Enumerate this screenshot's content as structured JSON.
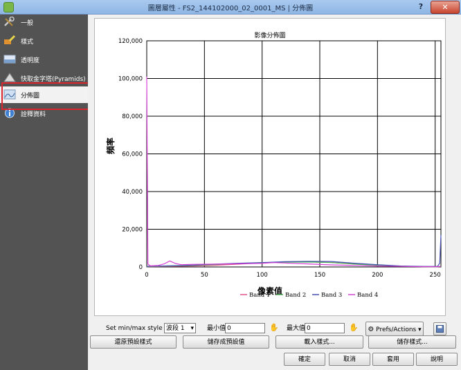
{
  "window": {
    "title": "圖層屬性 - FS2_144102000_02_0001_MS | 分佈圖",
    "help_label": "?",
    "close_label": "✕"
  },
  "sidebar": {
    "items": [
      {
        "label": "一般",
        "icon": "wrench-icon"
      },
      {
        "label": "樣式",
        "icon": "paintbrush-icon"
      },
      {
        "label": "透明度",
        "icon": "transparency-icon"
      },
      {
        "label": "快取金字塔(Pyramids)",
        "icon": "pyramid-icon"
      },
      {
        "label": "分佈圖",
        "icon": "histogram-icon"
      },
      {
        "label": "詮釋資料",
        "icon": "info-icon"
      }
    ],
    "selected_index": 4
  },
  "chart_data": {
    "type": "line",
    "title": "影像分佈圖",
    "xlabel": "像素值",
    "ylabel": "頻率",
    "xlim": [
      0,
      255
    ],
    "ylim": [
      0,
      120000
    ],
    "xticks": [
      "0",
      "50",
      "100",
      "150",
      "200",
      "250"
    ],
    "yticks": [
      "0",
      "20,000",
      "40,000",
      "60,000",
      "80,000",
      "100,000",
      "120,000"
    ],
    "legend_position": "bottom",
    "series": [
      {
        "name": "Band 1",
        "color": "#e2508a",
        "points": [
          [
            0,
            0
          ],
          [
            1,
            200
          ],
          [
            5,
            200
          ],
          [
            20,
            300
          ],
          [
            40,
            500
          ],
          [
            60,
            900
          ],
          [
            80,
            1500
          ],
          [
            100,
            2200
          ],
          [
            120,
            2600
          ],
          [
            140,
            2700
          ],
          [
            160,
            2400
          ],
          [
            180,
            1600
          ],
          [
            200,
            1000
          ],
          [
            220,
            400
          ],
          [
            240,
            200
          ],
          [
            252,
            100
          ],
          [
            254,
            200
          ],
          [
            255,
            500
          ]
        ]
      },
      {
        "name": "Band 2",
        "color": "#4fb55a",
        "points": [
          [
            0,
            0
          ],
          [
            1,
            300
          ],
          [
            5,
            300
          ],
          [
            20,
            500
          ],
          [
            40,
            800
          ],
          [
            60,
            1300
          ],
          [
            80,
            1900
          ],
          [
            100,
            2300
          ],
          [
            120,
            2500
          ],
          [
            140,
            2600
          ],
          [
            160,
            2300
          ],
          [
            180,
            1500
          ],
          [
            200,
            900
          ],
          [
            220,
            400
          ],
          [
            240,
            200
          ],
          [
            252,
            100
          ],
          [
            254,
            300
          ],
          [
            255,
            600
          ]
        ]
      },
      {
        "name": "Band 3",
        "color": "#4350b0",
        "points": [
          [
            0,
            0
          ],
          [
            1,
            400
          ],
          [
            5,
            400
          ],
          [
            20,
            600
          ],
          [
            40,
            1000
          ],
          [
            60,
            1500
          ],
          [
            80,
            2000
          ],
          [
            100,
            2300
          ],
          [
            120,
            2800
          ],
          [
            140,
            3000
          ],
          [
            160,
            2900
          ],
          [
            180,
            2000
          ],
          [
            200,
            1200
          ],
          [
            220,
            500
          ],
          [
            240,
            300
          ],
          [
            252,
            300
          ],
          [
            254,
            2000
          ],
          [
            255,
            17000
          ]
        ]
      },
      {
        "name": "Band 4",
        "color": "#d63fd6",
        "points": [
          [
            0,
            101000
          ],
          [
            1,
            1500
          ],
          [
            3,
            600
          ],
          [
            10,
            800
          ],
          [
            15,
            1600
          ],
          [
            20,
            3200
          ],
          [
            25,
            1800
          ],
          [
            30,
            1200
          ],
          [
            40,
            1400
          ],
          [
            60,
            1500
          ],
          [
            80,
            1700
          ],
          [
            100,
            1900
          ],
          [
            110,
            2300
          ],
          [
            120,
            2100
          ],
          [
            140,
            1600
          ],
          [
            160,
            1100
          ],
          [
            180,
            800
          ],
          [
            200,
            500
          ],
          [
            220,
            300
          ],
          [
            240,
            150
          ],
          [
            250,
            100
          ],
          [
            255,
            300
          ]
        ]
      }
    ]
  },
  "controls": {
    "minmax_label": "Set min/max style for",
    "band_select": "波段 1",
    "min_label": "最小值",
    "min_value": "0",
    "max_label": "最大值",
    "max_value": "0",
    "prefs_label": "Prefs/Actions"
  },
  "style_buttons": [
    "還原預設樣式",
    "儲存成預設值",
    "載入樣式...",
    "儲存樣式..."
  ],
  "dialog_buttons": [
    "確定",
    "取消",
    "套用",
    "說明"
  ]
}
